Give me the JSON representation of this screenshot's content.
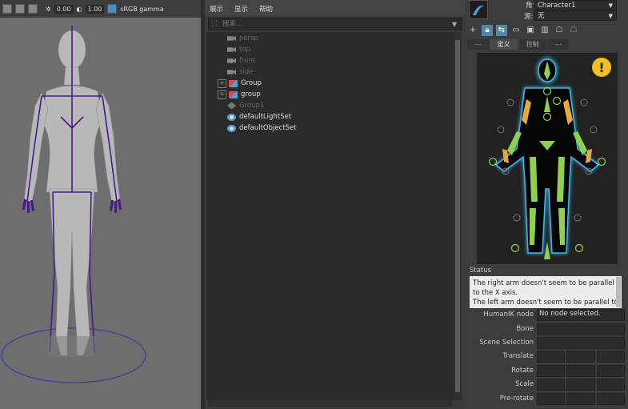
{
  "viewport": {
    "exposure": "0.00",
    "gamma": "1.00",
    "color_space": "sRGB gamma"
  },
  "outliner": {
    "menu": [
      "展示",
      "显示",
      "帮助"
    ],
    "search_placeholder": "搜索...",
    "items": [
      {
        "label": "persp",
        "icon": "camera-icon",
        "expand": false,
        "dim": true
      },
      {
        "label": "top",
        "icon": "camera-icon",
        "expand": false,
        "dim": true
      },
      {
        "label": "front",
        "icon": "camera-icon",
        "expand": false,
        "dim": true
      },
      {
        "label": "side",
        "icon": "camera-icon",
        "expand": false,
        "dim": true
      },
      {
        "label": "Group",
        "icon": "group-icon",
        "expand": true,
        "dim": false
      },
      {
        "label": "group",
        "icon": "group-icon",
        "expand": true,
        "dim": false
      },
      {
        "label": "Group1",
        "icon": "joint-icon",
        "expand": false,
        "dim": true
      },
      {
        "label": "defaultLightSet",
        "icon": "set-icon",
        "expand": false,
        "dim": false
      },
      {
        "label": "defaultObjectSet",
        "icon": "set-icon",
        "expand": false,
        "dim": false
      }
    ]
  },
  "hik": {
    "character_label": "角色:",
    "character_value": "Character1",
    "source_label": "源:",
    "source_value": "无",
    "tabs": [
      "---",
      "定义",
      "控制",
      "---"
    ],
    "selected_tab": 1,
    "status_label": "Status",
    "status_lines": [
      "The right arm doesn't seem to be parallel",
      "to the X axis.",
      "The left arm doesn't seem to be parallel to"
    ],
    "properties": {
      "humanik_node_label": "HumanIK node",
      "humanik_node_value": "No node selected.",
      "bone_label": "Bone",
      "scene_selection_label": "Scene Selection",
      "translate_label": "Translate",
      "rotate_label": "Rotate",
      "scale_label": "Scale",
      "prerotate_label": "Pre-rotate"
    },
    "colors": {
      "fk_green": "#8fd14f",
      "ik_orange": "#e8a93a",
      "body_outline": "#3fb8e8",
      "warning_yellow": "#f2c21b"
    }
  }
}
